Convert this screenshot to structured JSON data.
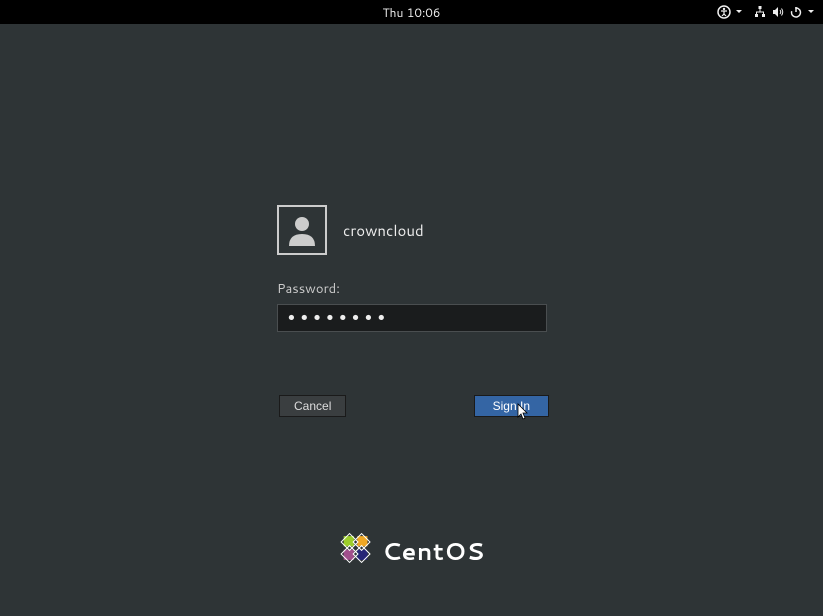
{
  "topbar": {
    "clock": "Thu 10:06"
  },
  "login": {
    "username": "crowncloud",
    "password_label": "Password:",
    "password_value": "••••••••"
  },
  "buttons": {
    "cancel": "Cancel",
    "signin": "Sign In"
  },
  "branding": {
    "name": "CentOS"
  }
}
